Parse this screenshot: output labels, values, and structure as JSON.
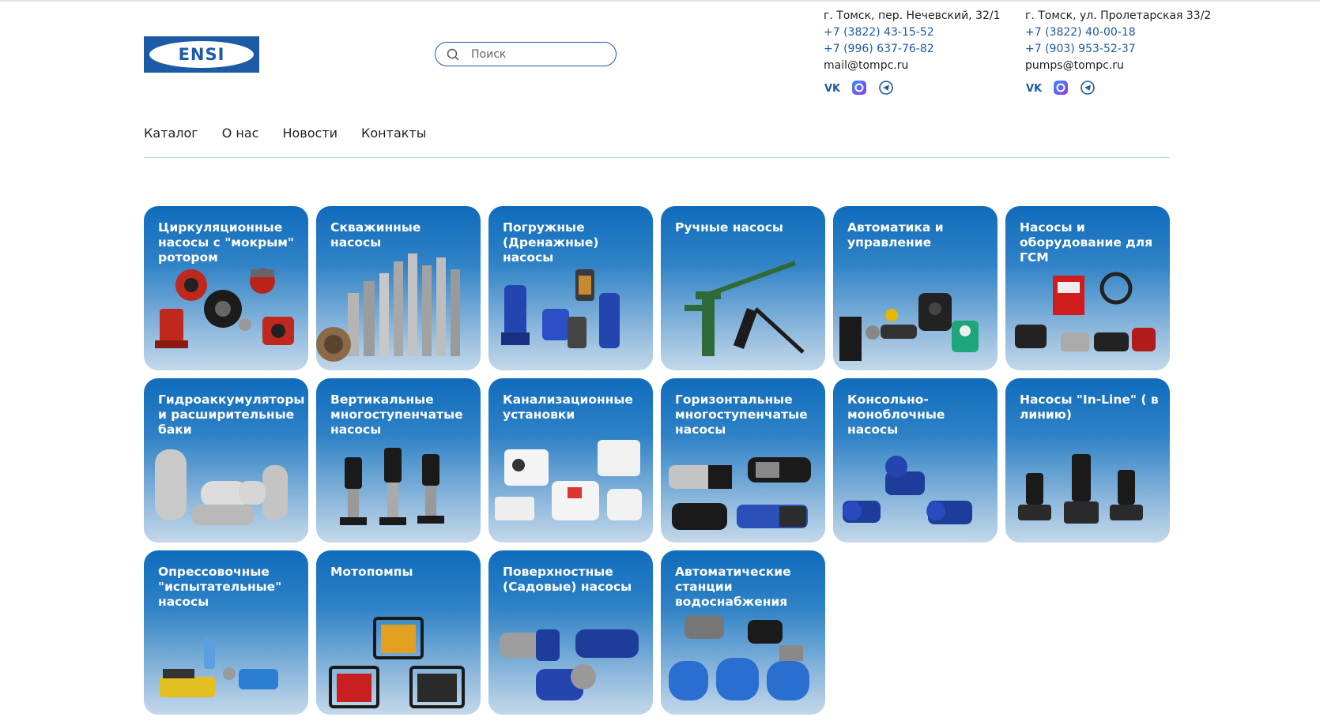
{
  "brand": {
    "logo_text": "ENSI",
    "color": "#1c5aa6"
  },
  "search": {
    "placeholder": "Поиск"
  },
  "contacts": [
    {
      "address": "г. Томск, пер. Нечевский, 32/1",
      "phones": [
        "+7 (3822) 43-15-52",
        "+7 (996) 637-76-82"
      ],
      "email": "mail@tompc.ru",
      "socials": [
        "vk-icon",
        "max-messenger-icon",
        "telegram-icon"
      ]
    },
    {
      "address": "г. Томск, ул. Пролетарская 33/2",
      "phones": [
        "+7 (3822) 40-00-18",
        "+7 (903) 953-52-37"
      ],
      "email": "pumps@tompc.ru",
      "socials": [
        "vk-icon",
        "max-messenger-icon",
        "telegram-icon"
      ]
    }
  ],
  "nav": [
    "Каталог",
    "О нас",
    "Новости",
    "Контакты"
  ],
  "categories": [
    {
      "title": "Циркуляционные насосы с \"мокрым\" ротором",
      "icon": "circulation-pumps-image"
    },
    {
      "title": "Скважинные насосы",
      "icon": "borehole-pumps-image"
    },
    {
      "title": "Погружные (Дренажные) насосы",
      "icon": "submersible-pumps-image"
    },
    {
      "title": "Ручные насосы",
      "icon": "hand-pump-image"
    },
    {
      "title": "Автоматика и управление",
      "icon": "automation-image"
    },
    {
      "title": "Насосы и оборудование для ГСМ",
      "icon": "fuel-pumps-image"
    },
    {
      "title": "Гидроаккумуляторы и расширительные баки",
      "icon": "tanks-image"
    },
    {
      "title": "Вертикальные многоступенчатые насосы",
      "icon": "vertical-pumps-image"
    },
    {
      "title": "Канализационные установки",
      "icon": "sewage-units-image"
    },
    {
      "title": "Горизонтальные многоступенчатые насосы",
      "icon": "horizontal-pumps-image"
    },
    {
      "title": "Консольно-моноблочные насосы",
      "icon": "monoblock-pumps-image"
    },
    {
      "title": "Насосы \"In-Line\" ( в линию)",
      "icon": "inline-pumps-image"
    },
    {
      "title": "Опрессовочные \"испытательные\" насосы",
      "icon": "pressure-test-pumps-image"
    },
    {
      "title": "Мотопомпы",
      "icon": "motor-pumps-image"
    },
    {
      "title": "Поверхностные (Садовые) насосы",
      "icon": "surface-pumps-image"
    },
    {
      "title": "Автоматические станции водоснабжения",
      "icon": "water-stations-image"
    }
  ]
}
